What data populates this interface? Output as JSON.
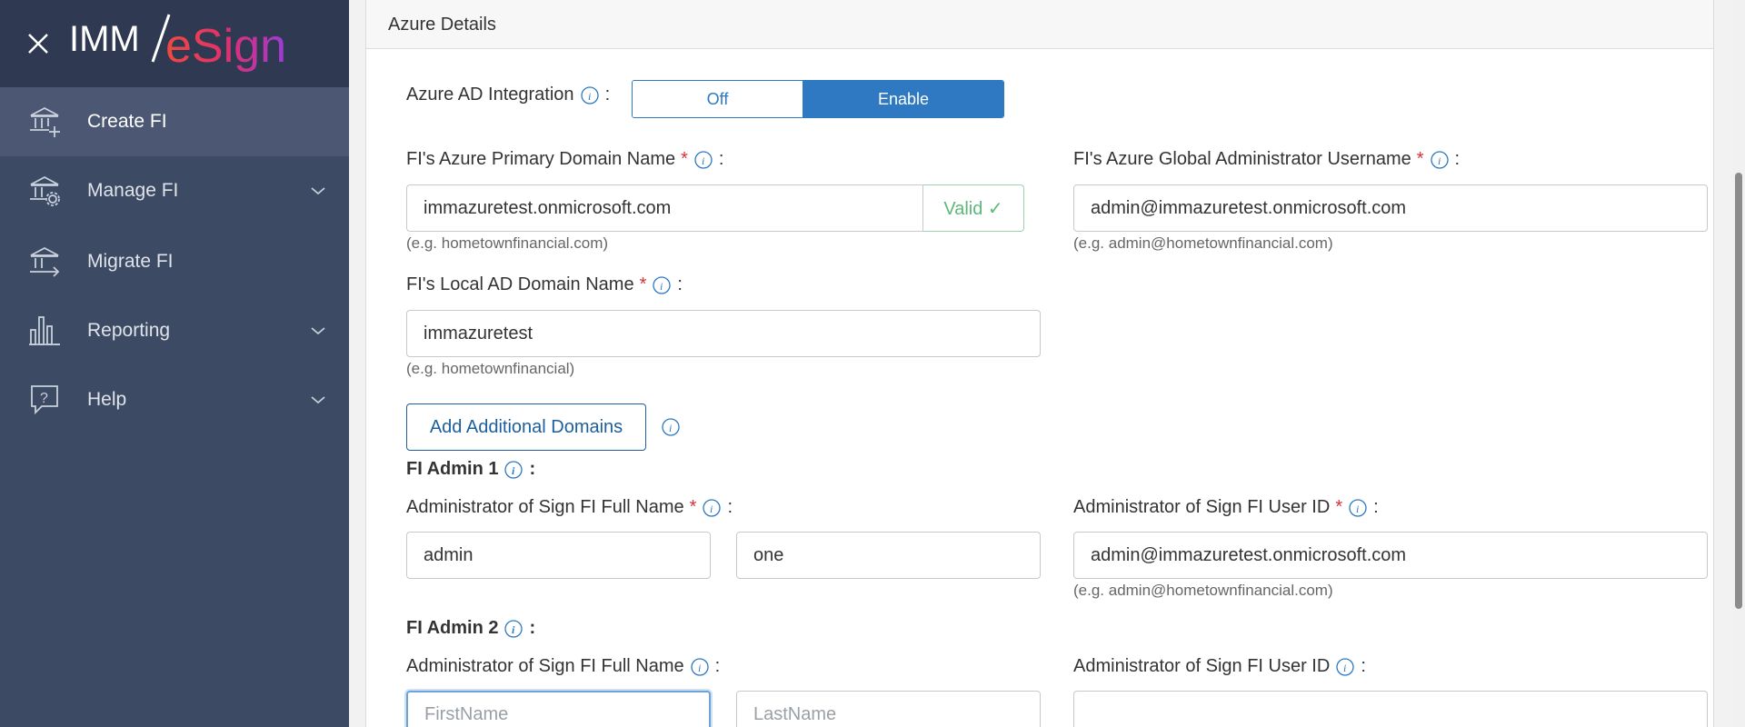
{
  "app": {
    "logo_text_left": "IMM",
    "logo_text_right": "eSign"
  },
  "sidebar": {
    "items": [
      {
        "label": "Create FI",
        "icon": "bank-plus-icon",
        "has_chevron": false
      },
      {
        "label": "Manage FI",
        "icon": "bank-gear-icon",
        "has_chevron": true
      },
      {
        "label": "Migrate FI",
        "icon": "bank-arrow-icon",
        "has_chevron": false
      },
      {
        "label": "Reporting",
        "icon": "bar-chart-icon",
        "has_chevron": true
      },
      {
        "label": "Help",
        "icon": "question-bubble-icon",
        "has_chevron": true
      }
    ]
  },
  "panel": {
    "title": "Azure Details",
    "azure_ad": {
      "label": "Azure AD Integration",
      "colon": ":",
      "off_label": "Off",
      "on_label": "Enable"
    },
    "primary_domain": {
      "label": "FI's Azure Primary Domain Name",
      "required": "*",
      "colon": ":",
      "value": "immazuretest.onmicrosoft.com",
      "valid_label": "Valid ✓",
      "hint": "(e.g. hometownfinancial.com)"
    },
    "global_admin": {
      "label": "FI's Azure Global Administrator Username",
      "required": "*",
      "colon": ":",
      "value": "admin@immazuretest.onmicrosoft.com",
      "hint": "(e.g. admin@hometownfinancial.com)"
    },
    "local_ad": {
      "label": "FI's Local AD Domain Name",
      "required": "*",
      "colon": ":",
      "value": "immazuretest",
      "hint": "(e.g. hometownfinancial)"
    },
    "add_domains_label": "Add Additional Domains",
    "admin1": {
      "heading": "FI Admin 1",
      "colon": ":",
      "fullname_label": "Administrator of Sign FI Full Name",
      "required": "*",
      "first_value": "admin",
      "last_value": "one",
      "userid_label": "Administrator of Sign FI User ID",
      "userid_value": "admin@immazuretest.onmicrosoft.com",
      "userid_hint": "(e.g. admin@hometownfinancial.com)"
    },
    "admin2": {
      "heading": "FI Admin 2",
      "colon": ":",
      "fullname_label": "Administrator of Sign FI Full Name",
      "first_placeholder": "FirstName",
      "last_placeholder": "LastName",
      "userid_label": "Administrator of Sign FI User ID",
      "userid_value": ""
    }
  }
}
